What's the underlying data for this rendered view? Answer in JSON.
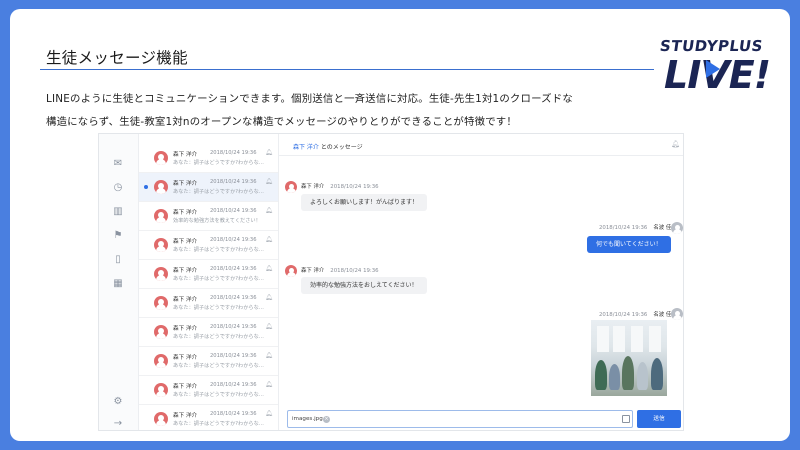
{
  "slide": {
    "title": "生徒メッセージ機能",
    "description_line1": "LINEのように生徒とコミュニケーションできます。個別送信と一斉送信に対応。生徒-先生1対1のクローズドな",
    "description_line2": "構造にならず、生徒-教室1対nのオープンな構造でメッセージのやりとりができることが特徴です！"
  },
  "brand": {
    "top": "STUDYPLUS",
    "bottom": "LIVE!"
  },
  "app": {
    "rail_icons": [
      "mail-icon",
      "clock-icon",
      "chart-icon",
      "flag-icon",
      "clipboard-icon",
      "calendar-icon",
      "gear-icon",
      "logout-icon"
    ],
    "conversation_list": [
      {
        "name": "森下 洋介",
        "date": "2018/10/24 19:36",
        "preview": "あなた：調子はどうですか?わからな…",
        "selected": false
      },
      {
        "name": "森下 洋介",
        "date": "2018/10/24 19:36",
        "preview": "あなた：調子はどうですか?わからな…",
        "selected": true
      },
      {
        "name": "森下 洋介",
        "date": "2018/10/24 19:36",
        "preview": "効率的な勉強方法を教えてください！",
        "selected": false
      },
      {
        "name": "森下 洋介",
        "date": "2018/10/24 19:36",
        "preview": "あなた：調子はどうですか?わからな…",
        "selected": false
      },
      {
        "name": "森下 洋介",
        "date": "2018/10/24 19:36",
        "preview": "あなた：調子はどうですか?わからな…",
        "selected": false
      },
      {
        "name": "森下 洋介",
        "date": "2018/10/24 19:36",
        "preview": "あなた：調子はどうですか?わからな…",
        "selected": false
      },
      {
        "name": "森下 洋介",
        "date": "2018/10/24 19:36",
        "preview": "あなた：調子はどうですか?わからな…",
        "selected": false
      },
      {
        "name": "森下 洋介",
        "date": "2018/10/24 19:36",
        "preview": "あなた：調子はどうですか?わからな…",
        "selected": false
      },
      {
        "name": "森下 洋介",
        "date": "2018/10/24 19:36",
        "preview": "あなた：調子はどうですか?わからな…",
        "selected": false
      },
      {
        "name": "森下 洋介",
        "date": "2018/10/24 19:36",
        "preview": "あなた：調子はどうですか?わからな…",
        "selected": false
      }
    ],
    "chat": {
      "header_name": "森下 洋介",
      "header_suffix": "とのメッセージ",
      "messages": [
        {
          "sender": "森下 洋介",
          "date": "2018/10/24 19:36",
          "text": "よろしくお願いします！がんばります！",
          "outgoing": false
        },
        {
          "sender": "名波 佳也",
          "date": "2018/10/24 19:36",
          "text": "何でも聞いてください！",
          "outgoing": true
        },
        {
          "sender": "森下 洋介",
          "date": "2018/10/24 19:36",
          "text": "効率的な勉強方法をおしえてください！",
          "outgoing": false
        },
        {
          "sender": "名波 佳也",
          "date": "2018/10/24 19:36",
          "text": "",
          "outgoing": true,
          "attachment": "photo"
        }
      ],
      "composer_attachment": "images.jpg",
      "send_label": "送信"
    }
  },
  "colors": {
    "frame": "#4a7fe0",
    "accent": "#2f6fe4",
    "brand": "#1b2554",
    "avatar": "#e06a6a"
  }
}
